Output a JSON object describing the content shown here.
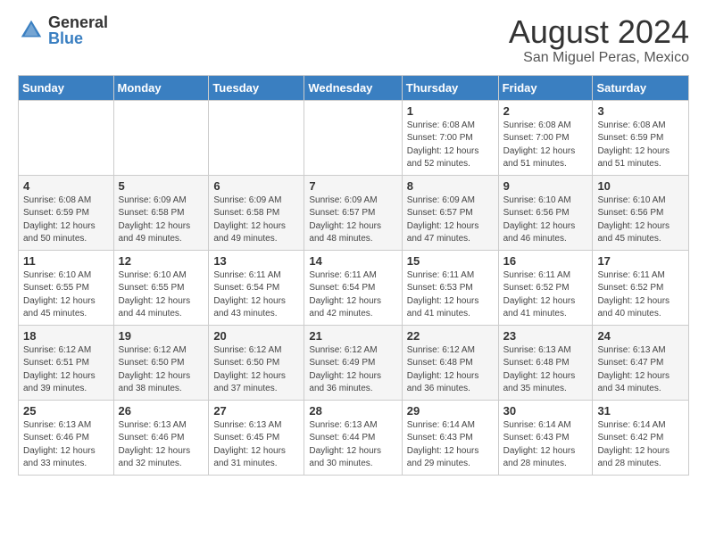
{
  "header": {
    "logo_general": "General",
    "logo_blue": "Blue",
    "month_year": "August 2024",
    "location": "San Miguel Peras, Mexico"
  },
  "days_of_week": [
    "Sunday",
    "Monday",
    "Tuesday",
    "Wednesday",
    "Thursday",
    "Friday",
    "Saturday"
  ],
  "weeks": [
    [
      {
        "day": "",
        "info": ""
      },
      {
        "day": "",
        "info": ""
      },
      {
        "day": "",
        "info": ""
      },
      {
        "day": "",
        "info": ""
      },
      {
        "day": "1",
        "info": "Sunrise: 6:08 AM\nSunset: 7:00 PM\nDaylight: 12 hours\nand 52 minutes."
      },
      {
        "day": "2",
        "info": "Sunrise: 6:08 AM\nSunset: 7:00 PM\nDaylight: 12 hours\nand 51 minutes."
      },
      {
        "day": "3",
        "info": "Sunrise: 6:08 AM\nSunset: 6:59 PM\nDaylight: 12 hours\nand 51 minutes."
      }
    ],
    [
      {
        "day": "4",
        "info": "Sunrise: 6:08 AM\nSunset: 6:59 PM\nDaylight: 12 hours\nand 50 minutes."
      },
      {
        "day": "5",
        "info": "Sunrise: 6:09 AM\nSunset: 6:58 PM\nDaylight: 12 hours\nand 49 minutes."
      },
      {
        "day": "6",
        "info": "Sunrise: 6:09 AM\nSunset: 6:58 PM\nDaylight: 12 hours\nand 49 minutes."
      },
      {
        "day": "7",
        "info": "Sunrise: 6:09 AM\nSunset: 6:57 PM\nDaylight: 12 hours\nand 48 minutes."
      },
      {
        "day": "8",
        "info": "Sunrise: 6:09 AM\nSunset: 6:57 PM\nDaylight: 12 hours\nand 47 minutes."
      },
      {
        "day": "9",
        "info": "Sunrise: 6:10 AM\nSunset: 6:56 PM\nDaylight: 12 hours\nand 46 minutes."
      },
      {
        "day": "10",
        "info": "Sunrise: 6:10 AM\nSunset: 6:56 PM\nDaylight: 12 hours\nand 45 minutes."
      }
    ],
    [
      {
        "day": "11",
        "info": "Sunrise: 6:10 AM\nSunset: 6:55 PM\nDaylight: 12 hours\nand 45 minutes."
      },
      {
        "day": "12",
        "info": "Sunrise: 6:10 AM\nSunset: 6:55 PM\nDaylight: 12 hours\nand 44 minutes."
      },
      {
        "day": "13",
        "info": "Sunrise: 6:11 AM\nSunset: 6:54 PM\nDaylight: 12 hours\nand 43 minutes."
      },
      {
        "day": "14",
        "info": "Sunrise: 6:11 AM\nSunset: 6:54 PM\nDaylight: 12 hours\nand 42 minutes."
      },
      {
        "day": "15",
        "info": "Sunrise: 6:11 AM\nSunset: 6:53 PM\nDaylight: 12 hours\nand 41 minutes."
      },
      {
        "day": "16",
        "info": "Sunrise: 6:11 AM\nSunset: 6:52 PM\nDaylight: 12 hours\nand 41 minutes."
      },
      {
        "day": "17",
        "info": "Sunrise: 6:11 AM\nSunset: 6:52 PM\nDaylight: 12 hours\nand 40 minutes."
      }
    ],
    [
      {
        "day": "18",
        "info": "Sunrise: 6:12 AM\nSunset: 6:51 PM\nDaylight: 12 hours\nand 39 minutes."
      },
      {
        "day": "19",
        "info": "Sunrise: 6:12 AM\nSunset: 6:50 PM\nDaylight: 12 hours\nand 38 minutes."
      },
      {
        "day": "20",
        "info": "Sunrise: 6:12 AM\nSunset: 6:50 PM\nDaylight: 12 hours\nand 37 minutes."
      },
      {
        "day": "21",
        "info": "Sunrise: 6:12 AM\nSunset: 6:49 PM\nDaylight: 12 hours\nand 36 minutes."
      },
      {
        "day": "22",
        "info": "Sunrise: 6:12 AM\nSunset: 6:48 PM\nDaylight: 12 hours\nand 36 minutes."
      },
      {
        "day": "23",
        "info": "Sunrise: 6:13 AM\nSunset: 6:48 PM\nDaylight: 12 hours\nand 35 minutes."
      },
      {
        "day": "24",
        "info": "Sunrise: 6:13 AM\nSunset: 6:47 PM\nDaylight: 12 hours\nand 34 minutes."
      }
    ],
    [
      {
        "day": "25",
        "info": "Sunrise: 6:13 AM\nSunset: 6:46 PM\nDaylight: 12 hours\nand 33 minutes."
      },
      {
        "day": "26",
        "info": "Sunrise: 6:13 AM\nSunset: 6:46 PM\nDaylight: 12 hours\nand 32 minutes."
      },
      {
        "day": "27",
        "info": "Sunrise: 6:13 AM\nSunset: 6:45 PM\nDaylight: 12 hours\nand 31 minutes."
      },
      {
        "day": "28",
        "info": "Sunrise: 6:13 AM\nSunset: 6:44 PM\nDaylight: 12 hours\nand 30 minutes."
      },
      {
        "day": "29",
        "info": "Sunrise: 6:14 AM\nSunset: 6:43 PM\nDaylight: 12 hours\nand 29 minutes."
      },
      {
        "day": "30",
        "info": "Sunrise: 6:14 AM\nSunset: 6:43 PM\nDaylight: 12 hours\nand 28 minutes."
      },
      {
        "day": "31",
        "info": "Sunrise: 6:14 AM\nSunset: 6:42 PM\nDaylight: 12 hours\nand 28 minutes."
      }
    ]
  ]
}
